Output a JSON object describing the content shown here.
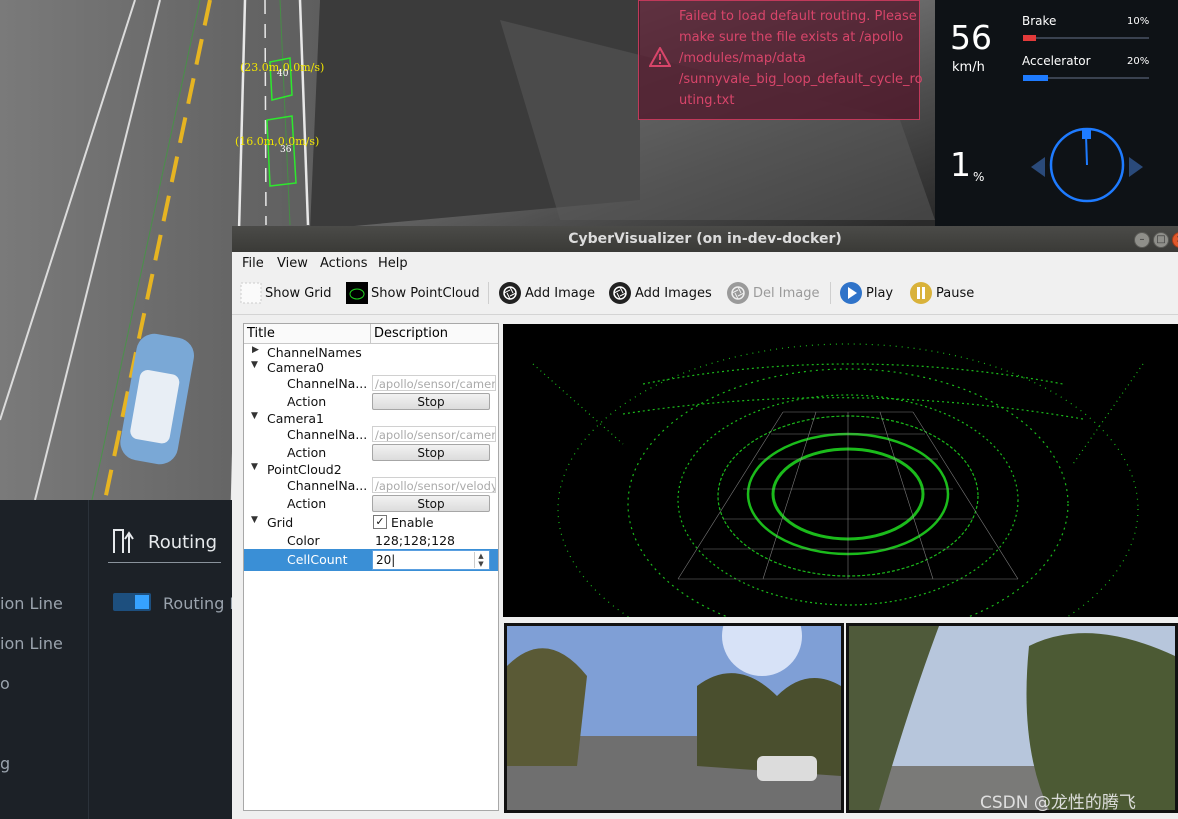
{
  "scene": {
    "obstacles": [
      {
        "label": "(23.0m,0.0m/s)",
        "id": "40"
      },
      {
        "label": "(16.0m,0.0m/s)",
        "id": "36"
      }
    ]
  },
  "error": {
    "message": "Failed to load default routing. Please make sure the file exists at /apollo /modules/map/data /sunnyvale_big_loop_default_cycle_ro uting.txt"
  },
  "dashboard": {
    "speed": "56",
    "speed_unit": "km/h",
    "brake": {
      "label": "Brake",
      "percent_text": "10%",
      "value": 0.1,
      "color": "#e23a3a"
    },
    "accelerator": {
      "label": "Accelerator",
      "percent_text": "20%",
      "value": 0.2,
      "color": "#1e7bff"
    },
    "steering": {
      "value": "1",
      "unit": "%"
    }
  },
  "left_panel": {
    "items": [
      "ion Line",
      "ion Line",
      "o",
      "g"
    ],
    "routing_title": "Routing",
    "routing_line_label": "Routing L"
  },
  "window": {
    "title": "CyberVisualizer (on in-dev-docker)",
    "menu": [
      "File",
      "View",
      "Actions",
      "Help"
    ],
    "toolbar": {
      "show_grid": "Show Grid",
      "show_pointcloud": "Show PointCloud",
      "add_image": "Add Image",
      "add_images": "Add Images",
      "del_image": "Del Image",
      "play": "Play",
      "pause": "Pause"
    },
    "tree": {
      "header": {
        "title": "Title",
        "description": "Description"
      },
      "channel_names": "ChannelNames",
      "camera0": {
        "name": "Camera0",
        "channel_label": "ChannelNa...",
        "channel_value": "/apollo/sensor/camera",
        "action_label": "Action",
        "action_button": "Stop"
      },
      "camera1": {
        "name": "Camera1",
        "channel_label": "ChannelNa...",
        "channel_value": "/apollo/sensor/camera",
        "action_label": "Action",
        "action_button": "Stop"
      },
      "pointcloud2": {
        "name": "PointCloud2",
        "channel_label": "ChannelNa...",
        "channel_value": "/apollo/sensor/velody",
        "action_label": "Action",
        "action_button": "Stop"
      },
      "grid": {
        "name": "Grid",
        "enable_label": "Enable",
        "enabled": true,
        "color_label": "Color",
        "color_value": "128;128;128",
        "cellcount_label": "CellCount",
        "cellcount_value": "20"
      }
    }
  },
  "watermark": "CSDN @龙性的腾飞",
  "colors": {
    "accent": "#3a8fd6",
    "pointcloud": "#1fd01f",
    "error": "#d8456a"
  }
}
